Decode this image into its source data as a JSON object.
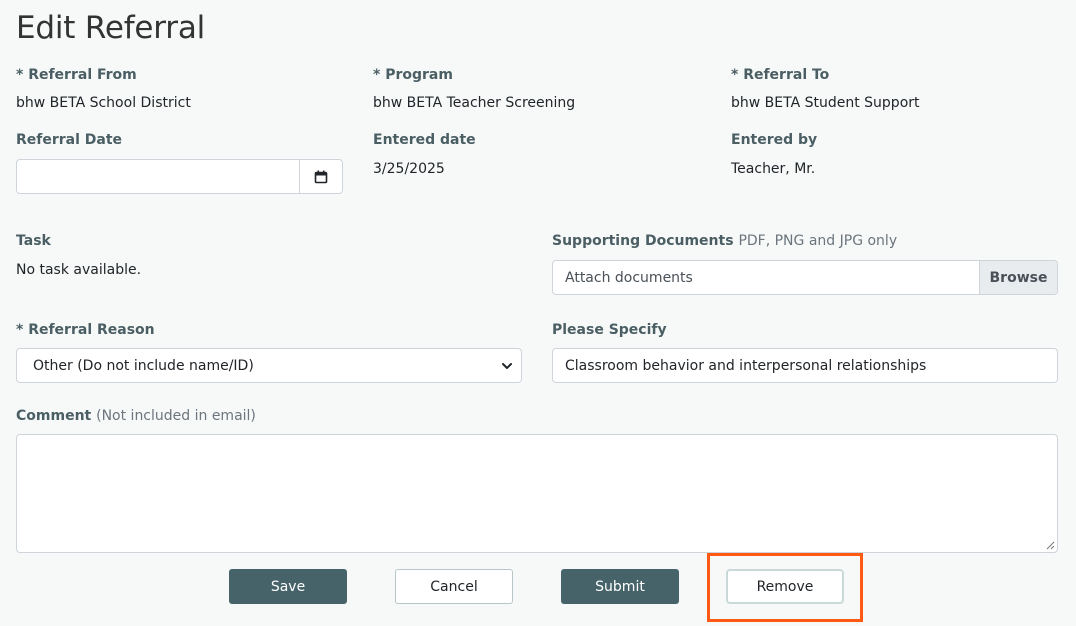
{
  "title": "Edit Referral",
  "referral_from": {
    "label": "* Referral From",
    "value": "bhw BETA School District"
  },
  "program": {
    "label": "* Program",
    "value": "bhw BETA Teacher Screening"
  },
  "referral_to": {
    "label": "* Referral To",
    "value": "bhw BETA Student Support"
  },
  "referral_date": {
    "label": "Referral Date",
    "value": ""
  },
  "entered_date": {
    "label": "Entered date",
    "value": "3/25/2025"
  },
  "entered_by": {
    "label": "Entered by",
    "value": "Teacher, Mr."
  },
  "task": {
    "label": "Task",
    "value": "No task available."
  },
  "supporting_documents": {
    "label": "Supporting Documents",
    "hint": "PDF, PNG and JPG only",
    "placeholder": "Attach documents",
    "browse_label": "Browse"
  },
  "referral_reason": {
    "label": "* Referral Reason",
    "selected": "Other (Do not include name/ID)"
  },
  "please_specify": {
    "label": "Please Specify",
    "value": "Classroom behavior and interpersonal relationships"
  },
  "comment": {
    "label": "Comment",
    "hint": "(Not included in email)",
    "value": ""
  },
  "buttons": {
    "save": "Save",
    "cancel": "Cancel",
    "submit": "Submit",
    "remove": "Remove"
  },
  "colors": {
    "primary": "#46636a",
    "label": "#4a5e63",
    "highlight": "#ff5a14"
  },
  "icons": {
    "date_picker": "calendar-icon",
    "select": "chevron-down-icon"
  }
}
